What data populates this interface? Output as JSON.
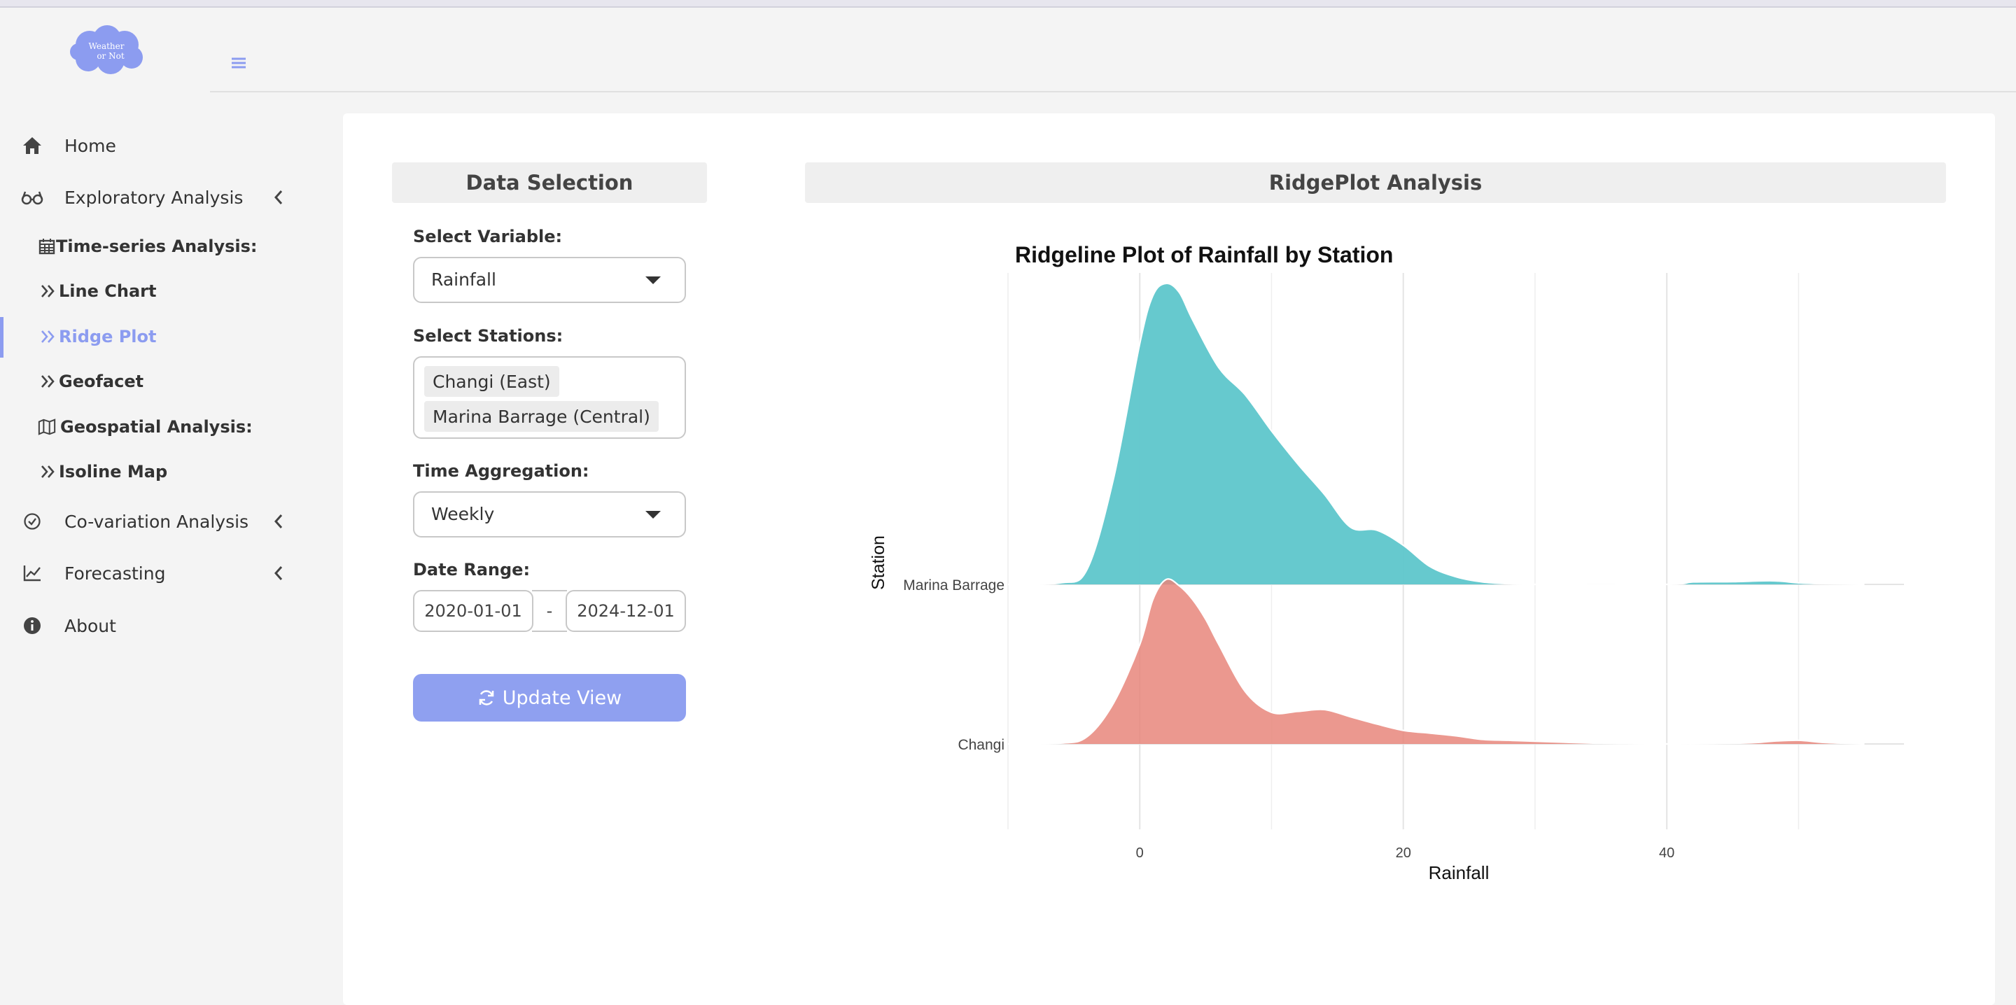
{
  "app": {
    "logo_text_line1": "Weather",
    "logo_text_line2": "or Not"
  },
  "sidebar": {
    "items": [
      {
        "label": "Home",
        "icon": "home-icon"
      },
      {
        "label": "Exploratory Analysis",
        "icon": "glasses-icon"
      },
      {
        "label": "Co-variation Analysis",
        "icon": "check-circle-icon"
      },
      {
        "label": "Forecasting",
        "icon": "line-chart-icon"
      },
      {
        "label": "About",
        "icon": "info-icon"
      }
    ],
    "sub_items": [
      {
        "label": "Time-series Analysis:",
        "icon": "calendar-icon"
      },
      {
        "label": "Line Chart",
        "icon": "double-chevron-icon"
      },
      {
        "label": "Ridge Plot",
        "icon": "double-chevron-icon",
        "active": true
      },
      {
        "label": "Geofacet",
        "icon": "double-chevron-icon"
      },
      {
        "label": "Geospatial Analysis:",
        "icon": "map-icon"
      },
      {
        "label": "Isoline Map",
        "icon": "double-chevron-icon"
      }
    ]
  },
  "data_selection": {
    "title": "Data Selection",
    "variable_label": "Select Variable:",
    "variable_value": "Rainfall",
    "stations_label": "Select Stations:",
    "stations": [
      "Changi (East)",
      "Marina Barrage (Central)"
    ],
    "aggregation_label": "Time Aggregation:",
    "aggregation_value": "Weekly",
    "date_label": "Date Range:",
    "date_start": "2020-01-01",
    "date_sep": "-",
    "date_end": "2024-12-01",
    "update_label": "Update View"
  },
  "analysis": {
    "title": "RidgePlot Analysis"
  },
  "colors": {
    "accent": "#8c9cf0",
    "marina": "#5ec6cb",
    "changi": "#e8867b"
  },
  "chart_data": {
    "type": "ridgeline",
    "title": "Ridgeline Plot of Rainfall by Station",
    "xlabel": "Rainfall",
    "ylabel": "Station",
    "xlim": [
      -10,
      58
    ],
    "xticks": [
      0,
      20,
      40
    ],
    "grid": true,
    "series": [
      {
        "name": "Marina Barrage",
        "color": "#5ec6cb",
        "x": [
          -10,
          -6,
          -4,
          -2,
          0,
          1,
          2,
          3,
          4,
          6,
          8,
          10,
          12,
          14,
          16,
          18,
          20,
          22,
          24,
          26,
          28,
          30,
          40,
          42,
          45,
          48,
          50,
          52,
          55
        ],
        "density": [
          0,
          0.005,
          0.05,
          0.35,
          0.8,
          0.96,
          1.0,
          0.97,
          0.88,
          0.72,
          0.63,
          0.51,
          0.4,
          0.3,
          0.19,
          0.18,
          0.13,
          0.06,
          0.025,
          0.008,
          0.002,
          0,
          0,
          0.008,
          0.009,
          0.012,
          0.005,
          0.002,
          0
        ]
      },
      {
        "name": "Changi",
        "color": "#e8867b",
        "x": [
          -10,
          -6,
          -4,
          -2,
          0,
          1,
          2,
          3,
          4,
          5,
          6,
          8,
          10,
          12,
          14,
          16,
          18,
          20,
          22,
          24,
          26,
          28,
          30,
          32,
          34,
          36,
          40,
          46,
          48,
          50,
          52,
          55
        ],
        "density": [
          0,
          0.008,
          0.08,
          0.45,
          1.1,
          1.6,
          1.82,
          1.75,
          1.6,
          1.38,
          1.1,
          0.58,
          0.35,
          0.36,
          0.38,
          0.3,
          0.22,
          0.15,
          0.12,
          0.09,
          0.05,
          0.04,
          0.03,
          0.02,
          0.01,
          0.005,
          0,
          0.01,
          0.03,
          0.04,
          0.015,
          0
        ]
      }
    ]
  }
}
